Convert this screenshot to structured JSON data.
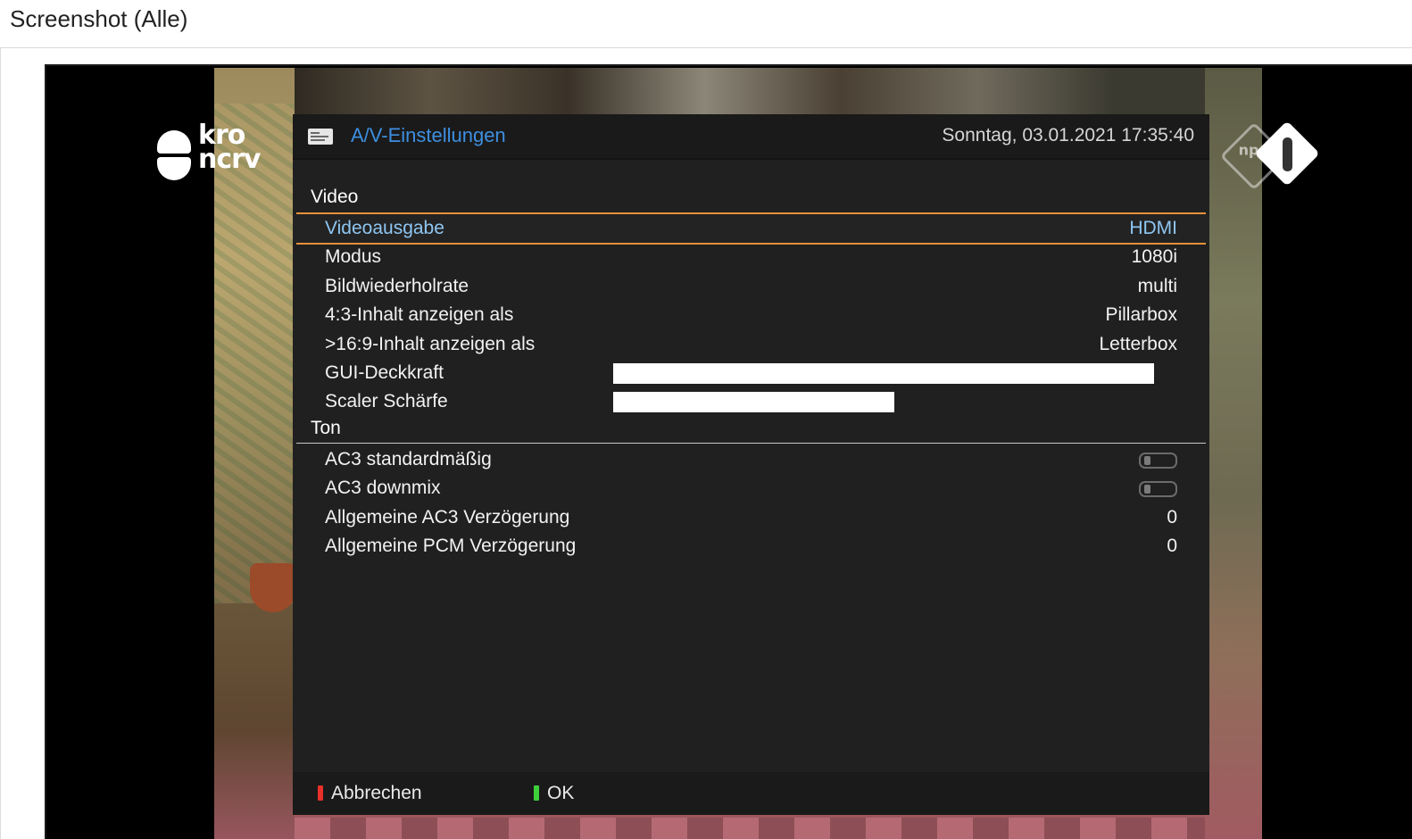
{
  "page": {
    "heading": "Screenshot (Alle)"
  },
  "channel_logos": {
    "left": "kro ncrv",
    "right": "npo 1"
  },
  "osd": {
    "title": "A/V-Einstellungen",
    "title_icon": "screen-icon",
    "datetime": "Sonntag, 03.01.2021  17:35:40",
    "sections": [
      {
        "label": "Video"
      },
      {
        "label": "Ton"
      }
    ],
    "video_items": [
      {
        "label": "Videoausgabe",
        "value": "HDMI",
        "selected": true
      },
      {
        "label": "Modus",
        "value": "1080i"
      },
      {
        "label": "Bildwiederholrate",
        "value": "multi"
      },
      {
        "label": "4:3-Inhalt anzeigen als",
        "value": "Pillarbox"
      },
      {
        "label": ">16:9-Inhalt anzeigen als",
        "value": "Letterbox"
      },
      {
        "label": "GUI-Deckkraft",
        "slider_fraction": 1.0
      },
      {
        "label": "Scaler Schärfe",
        "slider_fraction": 0.52
      }
    ],
    "audio_items": [
      {
        "label": "AC3 standardmäßig",
        "toggle": "off"
      },
      {
        "label": "AC3 downmix",
        "toggle": "off"
      },
      {
        "label": "Allgemeine AC3 Verzögerung",
        "value": "0"
      },
      {
        "label": "Allgemeine PCM Verzögerung",
        "value": "0"
      }
    ],
    "footer": {
      "cancel_label": "Abbrechen",
      "cancel_color": "#e8312a",
      "ok_label": "OK",
      "ok_color": "#3ecf3a"
    },
    "colors": {
      "title": "#3d8fe0",
      "selection_border": "#e8913a",
      "selected_text": "#8ec6f2"
    }
  }
}
